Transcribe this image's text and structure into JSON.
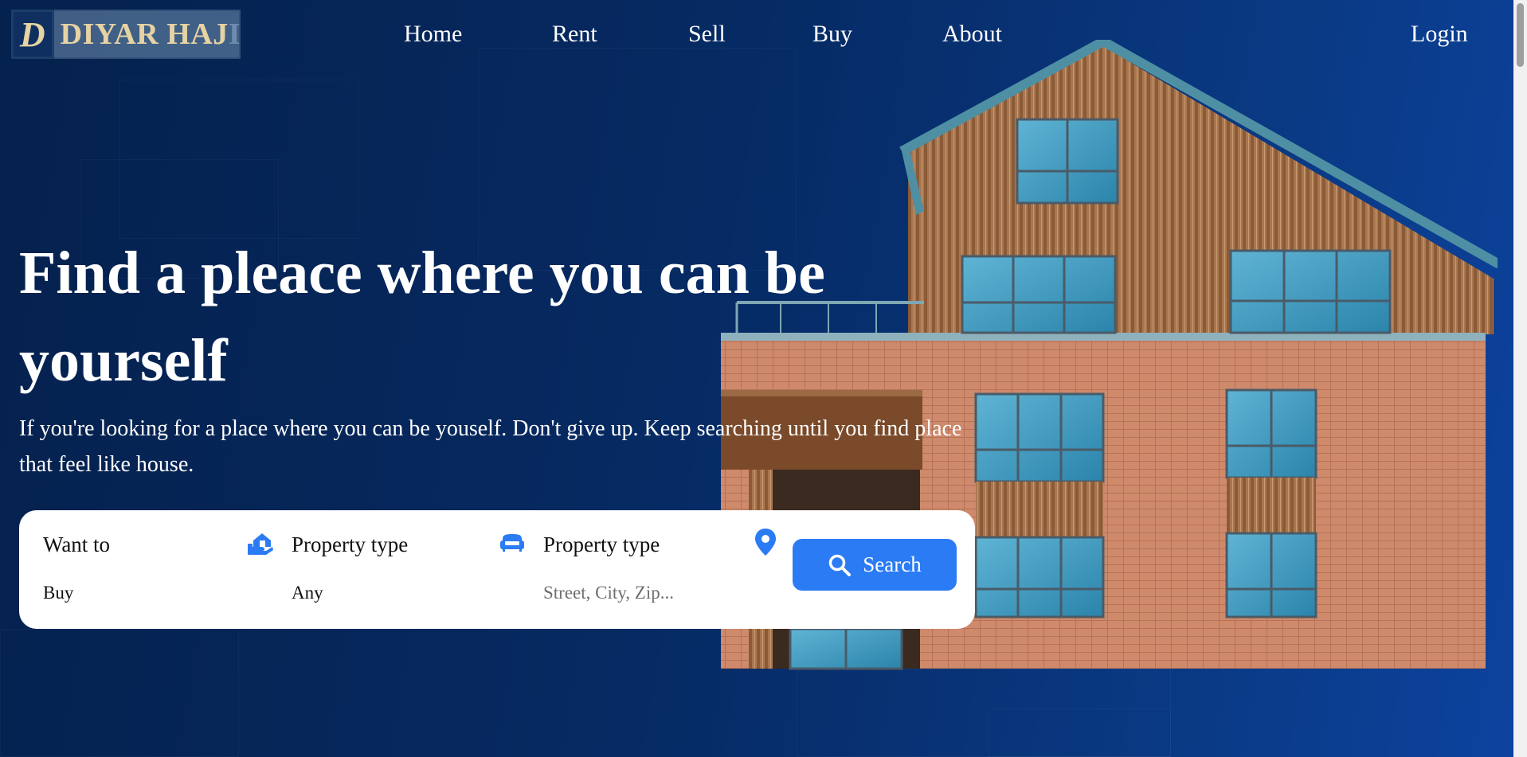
{
  "brand": {
    "logo_letter": "D",
    "name": "DIYAR HAJ",
    "name_faded": "I"
  },
  "nav": {
    "items": [
      "Home",
      "Rent",
      "Sell",
      "Buy",
      "About"
    ],
    "login": "Login"
  },
  "hero": {
    "title": "Find a pleace where you can be yourself",
    "subtitle": "If you're looking for a place where you can be youself. Don't give up. Keep searching until you find place that feel like house."
  },
  "search": {
    "fields": [
      {
        "label": "Want to",
        "value": "Buy",
        "icon": "house-hand-icon"
      },
      {
        "label": "Property type",
        "value": "Any",
        "icon": "sofa-icon"
      },
      {
        "label": "Property type",
        "placeholder": "Street, City, Zip...",
        "icon": "location-pin-icon"
      }
    ],
    "button_label": "Search",
    "button_icon": "search-icon"
  },
  "colors": {
    "accent": "#2a7bf4",
    "brand_gold": "#e6d3a3",
    "background_dark": "#05214d",
    "background_light": "#0d43a0"
  }
}
